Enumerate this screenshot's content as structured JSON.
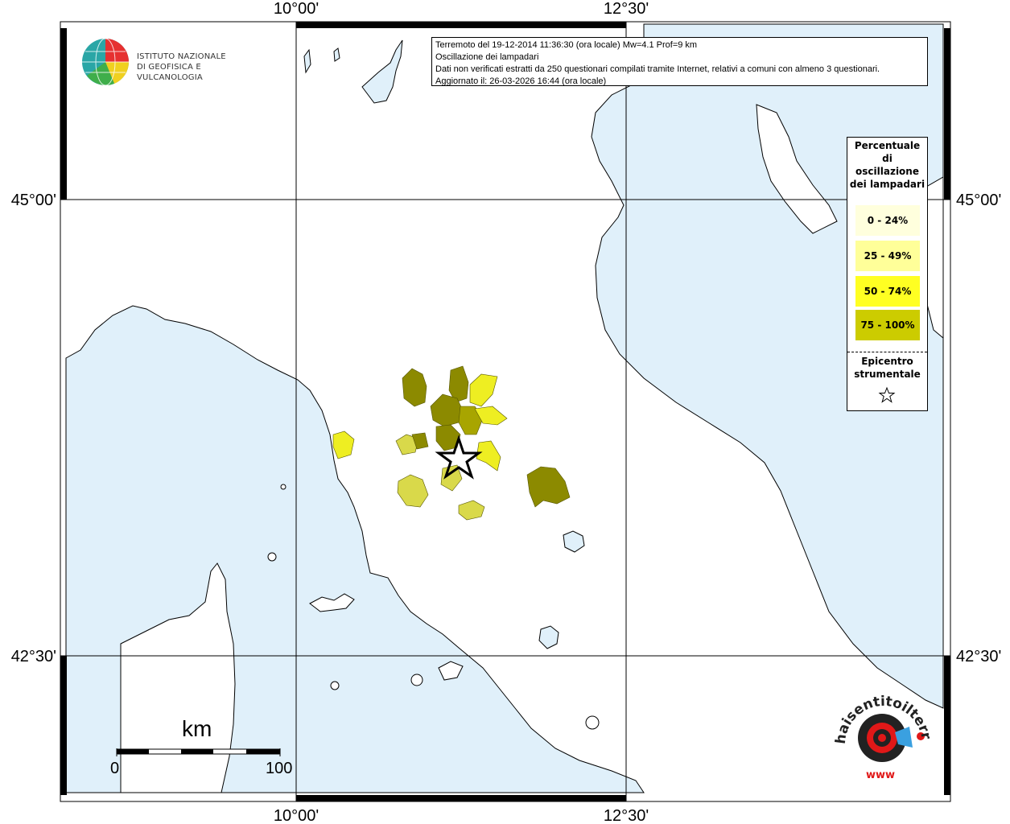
{
  "axes": {
    "lon_labels": [
      "10°00'",
      "12°30'"
    ],
    "lat_labels": [
      "45°00'",
      "42°30'"
    ]
  },
  "header": {
    "line1": "Terremoto del 19-12-2014 11:36:30 (ora locale) Mw=4.1 Prof=9 km",
    "line2": "Oscillazione dei lampadari",
    "line3": "Dati non verificati estratti da 250 questionari compilati tramite Internet, relativi a comuni con almeno 3 questionari.",
    "line4": "Aggiornato il: 26-03-2026 16:44 (ora locale)"
  },
  "institute": {
    "line1": "ISTITUTO NAZIONALE",
    "line2": "DI GEOFISICA E VULCANOLOGIA"
  },
  "legend": {
    "title": "Percentuale di oscillazione dei lampadari",
    "classes": [
      {
        "label": "0 - 24%",
        "color": "#ffffdd"
      },
      {
        "label": "25 - 49%",
        "color": "#ffff99"
      },
      {
        "label": "50 - 74%",
        "color": "#ffff22"
      },
      {
        "label": "75 - 100%",
        "color": "#cccc00"
      }
    ],
    "epicenter_label": "Epicentro strumentale"
  },
  "scale": {
    "unit": "km",
    "min": "0",
    "max": "100"
  },
  "watermark": {
    "text": "haisentitoilterremoto.it",
    "url": "www"
  },
  "colors": {
    "sea": "#e0f0fa",
    "land": "#ffffff",
    "class_dark": "#8c8a00",
    "class_olive": "#a8a500",
    "class_yellow": "#eeee22",
    "class_pale": "#d9d94a"
  }
}
